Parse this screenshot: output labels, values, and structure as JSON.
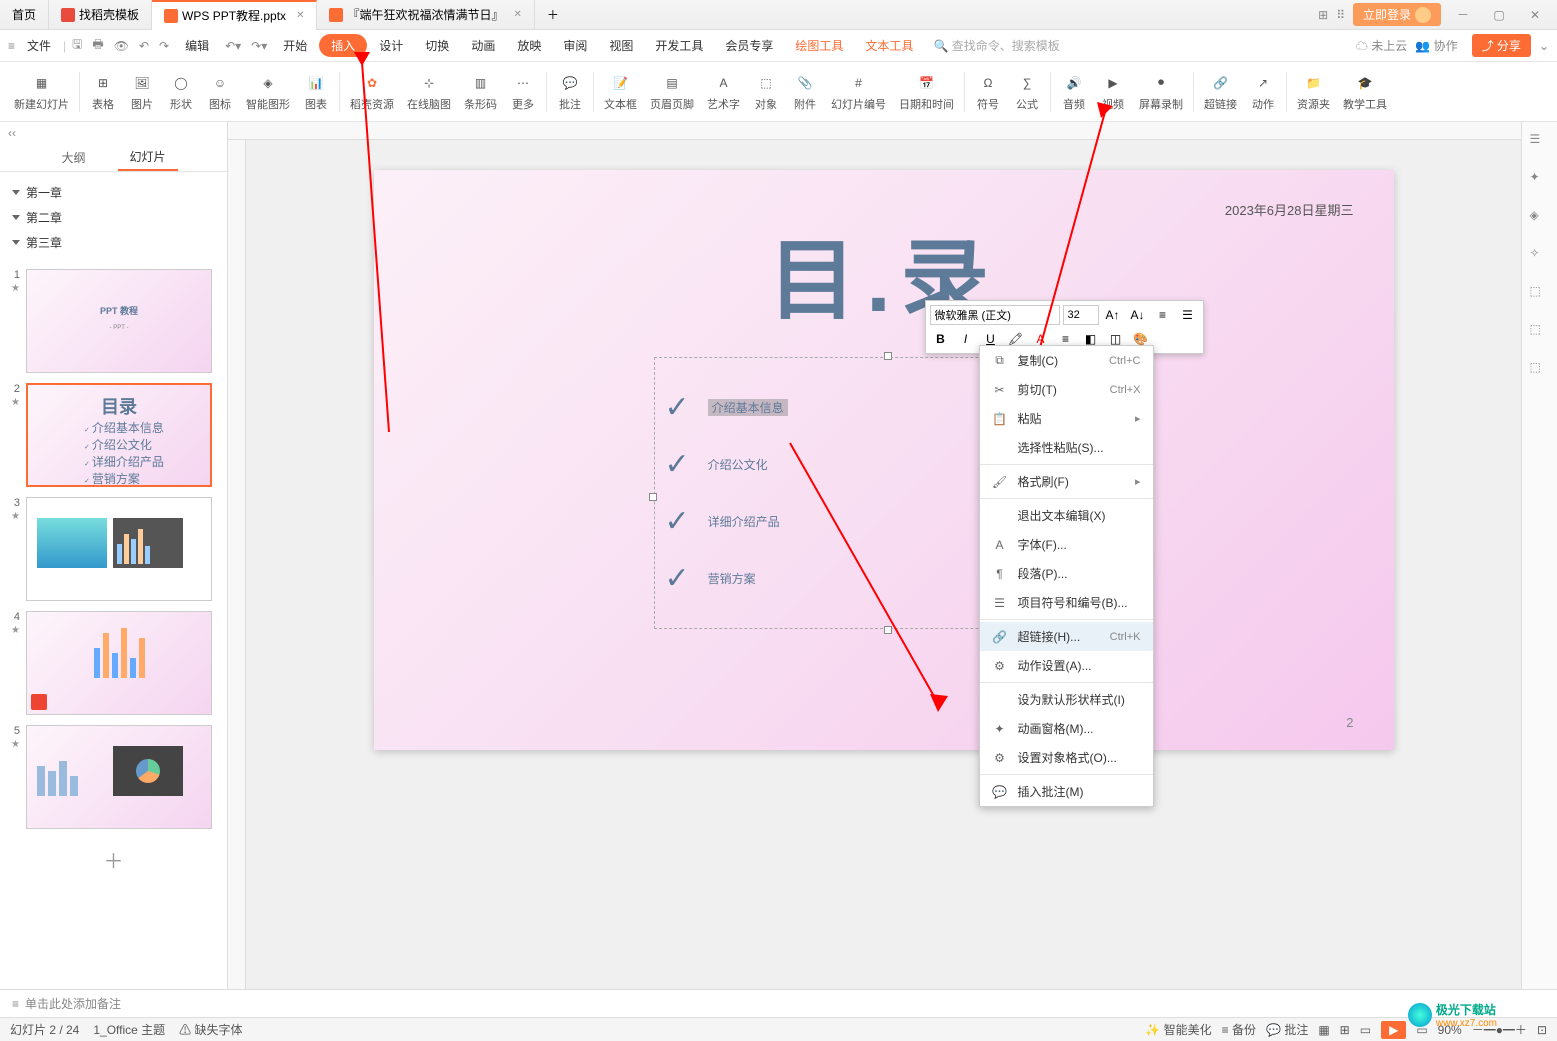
{
  "tabs": [
    {
      "label": "首页",
      "icon": "#4a90d9"
    },
    {
      "label": "找稻壳模板",
      "icon": "#e94c3d"
    },
    {
      "label": "WPS PPT教程.pptx",
      "icon": "#fd6c35",
      "active": true
    },
    {
      "label": "『端午狂欢祝福浓情满节日』",
      "icon": "#fd6c35"
    }
  ],
  "titlebar": {
    "login": "立即登录"
  },
  "menu": {
    "file": "文件",
    "items": [
      "编辑",
      "开始",
      "插入",
      "设计",
      "切换",
      "动画",
      "放映",
      "审阅",
      "视图",
      "开发工具",
      "会员专享",
      "绘图工具",
      "文本工具"
    ],
    "search": "查找命令、搜索模板",
    "cloud": "未上云",
    "collab": "协作",
    "share": "分享"
  },
  "toolbar": {
    "items": [
      "新建幻灯片",
      "表格",
      "图片",
      "形状",
      "图标",
      "智能图形",
      "图表",
      "稻壳资源",
      "在线脑图",
      "条形码",
      "更多",
      "批注",
      "文本框",
      "页眉页脚",
      "艺术字",
      "对象",
      "附件",
      "幻灯片编号",
      "日期和时间",
      "符号",
      "公式",
      "音频",
      "视频",
      "屏幕录制",
      "超链接",
      "动作",
      "资源夹",
      "教学工具"
    ]
  },
  "panel": {
    "tab_outline": "大纲",
    "tab_slides": "幻灯片",
    "chapters": [
      "第一章",
      "第二章",
      "第三章"
    ]
  },
  "slide": {
    "title": "目.录",
    "date": "2023年6月28日星期三",
    "page": "2",
    "items": [
      "介绍基本信息",
      "介绍公文化",
      "详细介绍产品",
      "营销方案"
    ]
  },
  "thumb2": {
    "title": "目录",
    "items": [
      "介绍基本信息",
      "介绍公文化",
      "详细介绍产品",
      "营销方案"
    ]
  },
  "float": {
    "font": "微软雅黑 (正文)",
    "size": "32"
  },
  "context": {
    "copy": "复制(C)",
    "cut": "剪切(T)",
    "paste": "粘贴",
    "paste_special": "选择性粘贴(S)...",
    "format_painter": "格式刷(F)",
    "exit": "退出文本编辑(X)",
    "font": "字体(F)...",
    "para": "段落(P)...",
    "bullets": "项目符号和编号(B)...",
    "hyperlink": "超链接(H)...",
    "action": "动作设置(A)...",
    "default_shape": "设为默认形状样式(I)",
    "anim": "动画窗格(M)...",
    "obj_format": "设置对象格式(O)...",
    "comment": "插入批注(M)",
    "sc_copy": "Ctrl+C",
    "sc_cut": "Ctrl+X",
    "sc_link": "Ctrl+K"
  },
  "notes": "单击此处添加备注",
  "status": {
    "page": "幻灯片 2 / 24",
    "theme": "1_Office 主题",
    "missing": "缺失字体",
    "beautify": "智能美化",
    "backup": "备份",
    "comments": "批注",
    "zoom": "90%"
  },
  "watermark": {
    "name": "极光下载站",
    "url": "www.xz7.com"
  }
}
